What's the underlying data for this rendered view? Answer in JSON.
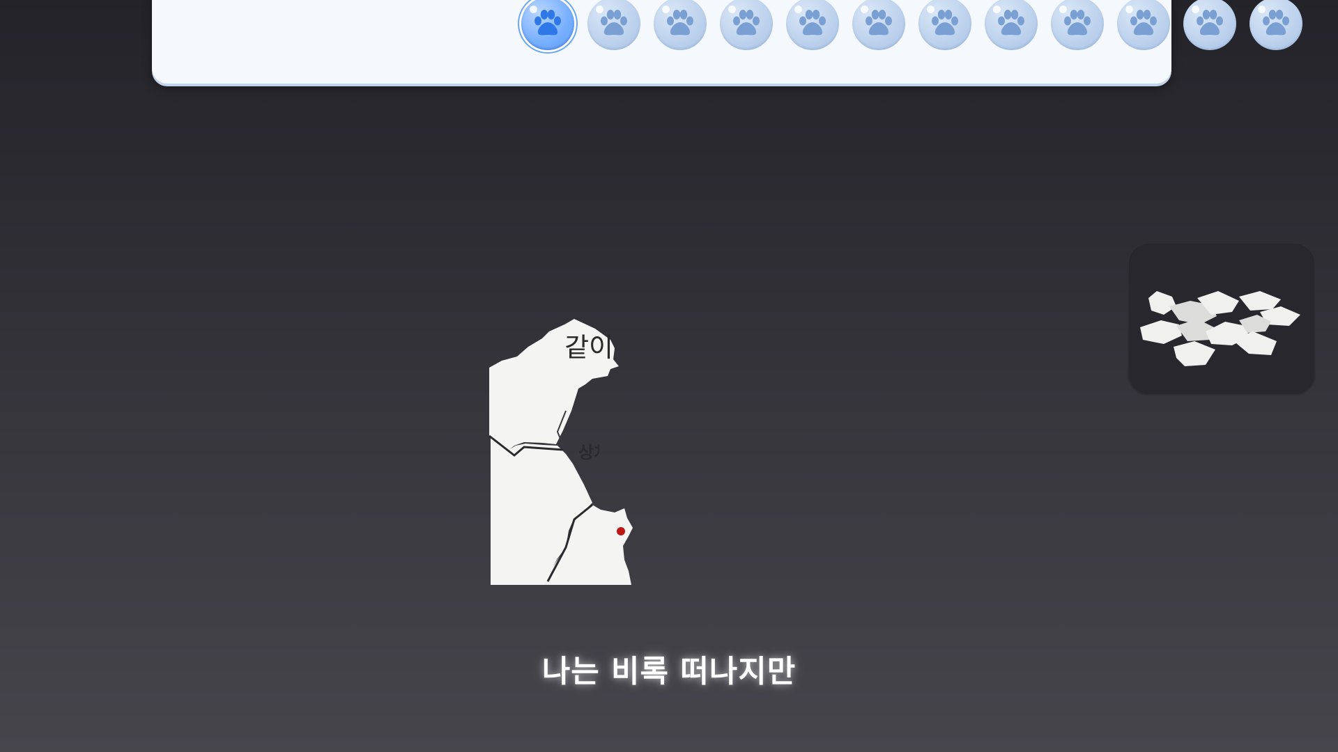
{
  "chapter_bar": {
    "chapters": [
      {
        "icon": "paw-icon",
        "state": "current"
      },
      {
        "icon": "paw-icon",
        "state": "locked"
      },
      {
        "icon": "paw-icon",
        "state": "locked"
      },
      {
        "icon": "paw-icon",
        "state": "locked"
      },
      {
        "icon": "paw-icon",
        "state": "locked"
      },
      {
        "icon": "paw-icon",
        "state": "locked"
      },
      {
        "icon": "paw-icon",
        "state": "locked"
      },
      {
        "icon": "paw-icon",
        "state": "locked"
      },
      {
        "icon": "paw-icon",
        "state": "locked"
      },
      {
        "icon": "paw-icon",
        "state": "locked"
      },
      {
        "icon": "paw-icon",
        "state": "locked"
      },
      {
        "icon": "paw-icon",
        "state": "locked"
      }
    ],
    "accent_color": "#5c9bf6",
    "inactive_color": "#bcd1ec"
  },
  "puzzle": {
    "piece_texts": [
      "같이",
      "상처"
    ],
    "marker_color": "#c01515"
  },
  "tray": {
    "label": "",
    "scrap_color": "#f0f0ef"
  },
  "subtitle": {
    "text": "나는 비록 떠나지만"
  }
}
